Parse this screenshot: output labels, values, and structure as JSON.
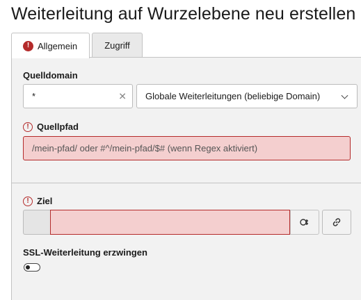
{
  "page": {
    "title": "Weiterleitung auf Wurzelebene neu erstellen"
  },
  "tabs": [
    {
      "label": "Allgemein",
      "active": true,
      "has_error": true
    },
    {
      "label": "Zugriff",
      "active": false,
      "has_error": false
    }
  ],
  "form": {
    "source_domain": {
      "label": "Quelldomain",
      "value": "*",
      "select_value": "Globale Weiterleitungen (beliebige Domain)"
    },
    "source_path": {
      "label": "Quellpfad",
      "placeholder": "/mein-pfad/ oder #^/mein-pfad/$# (wenn Regex aktiviert)",
      "invalid": true
    },
    "target": {
      "label": "Ziel",
      "value": "",
      "invalid": true
    },
    "force_ssl": {
      "label": "SSL-Weiterleitung erzwingen",
      "checked": false
    }
  },
  "icons": {
    "error": "exclamation-circle-icon",
    "clear": "close-icon",
    "chevron": "chevron-down-icon",
    "wizard": "link-browser-icon",
    "link": "link-icon"
  },
  "colors": {
    "error": "#b42b2b",
    "invalid_bg": "#f4cfcf",
    "panel_bg": "#f2f2f2",
    "inactive_tab_bg": "#e9e9e9"
  }
}
